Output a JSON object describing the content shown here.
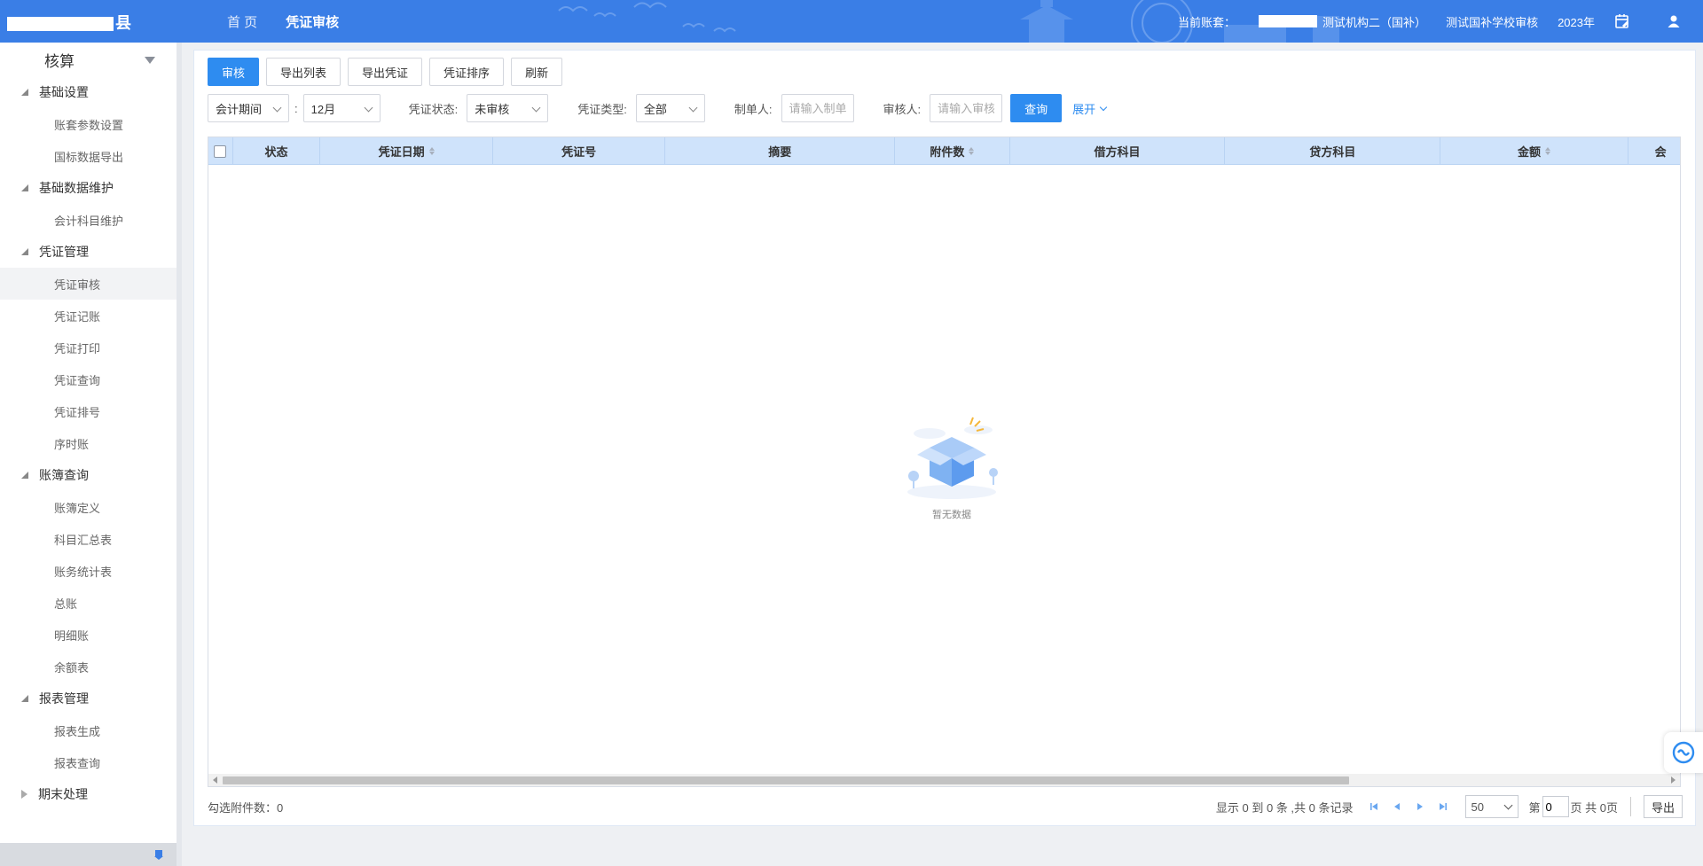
{
  "header": {
    "logo_suffix": "县",
    "nav": [
      {
        "label": "首 页"
      },
      {
        "label": "凭证审核"
      }
    ],
    "account_label": "当前账套：",
    "org": "测试机构二（国补）",
    "school": "测试国补学校审核",
    "year": "2023年"
  },
  "sidebar": {
    "title": "核算",
    "groups": [
      {
        "label": "基础设置",
        "items": [
          "账套参数设置",
          "国标数据导出"
        ]
      },
      {
        "label": "基础数据维护",
        "items": [
          "会计科目维护"
        ]
      },
      {
        "label": "凭证管理",
        "items": [
          "凭证审核",
          "凭证记账",
          "凭证打印",
          "凭证查询",
          "凭证排号",
          "序时账"
        ]
      },
      {
        "label": "账簿查询",
        "items": [
          "账簿定义",
          "科目汇总表",
          "账务统计表",
          "总账",
          "明细账",
          "余额表"
        ]
      },
      {
        "label": "报表管理",
        "items": [
          "报表生成",
          "报表查询"
        ]
      },
      {
        "label": "期末处理",
        "items": []
      }
    ]
  },
  "toolbar": {
    "audit": "审核",
    "export_list": "导出列表",
    "export_voucher": "导出凭证",
    "voucher_sort": "凭证排序",
    "refresh": "刷新"
  },
  "filters": {
    "period_type": "会计期间",
    "colon": ":",
    "month": "12月",
    "status_label": "凭证状态:",
    "status_value": "未审核",
    "type_label": "凭证类型:",
    "type_value": "全部",
    "maker_label": "制单人:",
    "maker_placeholder": "请输入制单人",
    "auditor_label": "审核人:",
    "auditor_placeholder": "请输入审核人",
    "query": "查询",
    "expand": "展开"
  },
  "table": {
    "columns": [
      {
        "label": "状态",
        "sortable": false
      },
      {
        "label": "凭证日期",
        "sortable": true
      },
      {
        "label": "凭证号",
        "sortable": false
      },
      {
        "label": "摘要",
        "sortable": false
      },
      {
        "label": "附件数",
        "sortable": true
      },
      {
        "label": "借方科目",
        "sortable": false
      },
      {
        "label": "贷方科目",
        "sortable": false
      },
      {
        "label": "金额",
        "sortable": true
      },
      {
        "label": "会",
        "sortable": false
      }
    ],
    "empty_text": "暂无数据"
  },
  "footer": {
    "selected_attach": "勾选附件数：0",
    "summary": "显示 0 到 0 条 ,共 0 条记录",
    "page_size": "50",
    "page_prefix": "第",
    "page_value": "0",
    "page_suffix": "页 共 0页",
    "export": "导出"
  },
  "colors": {
    "header_bg": "#3a7ee6",
    "primary": "#2e8cf0",
    "table_header_bg": "#cfe3fb"
  }
}
